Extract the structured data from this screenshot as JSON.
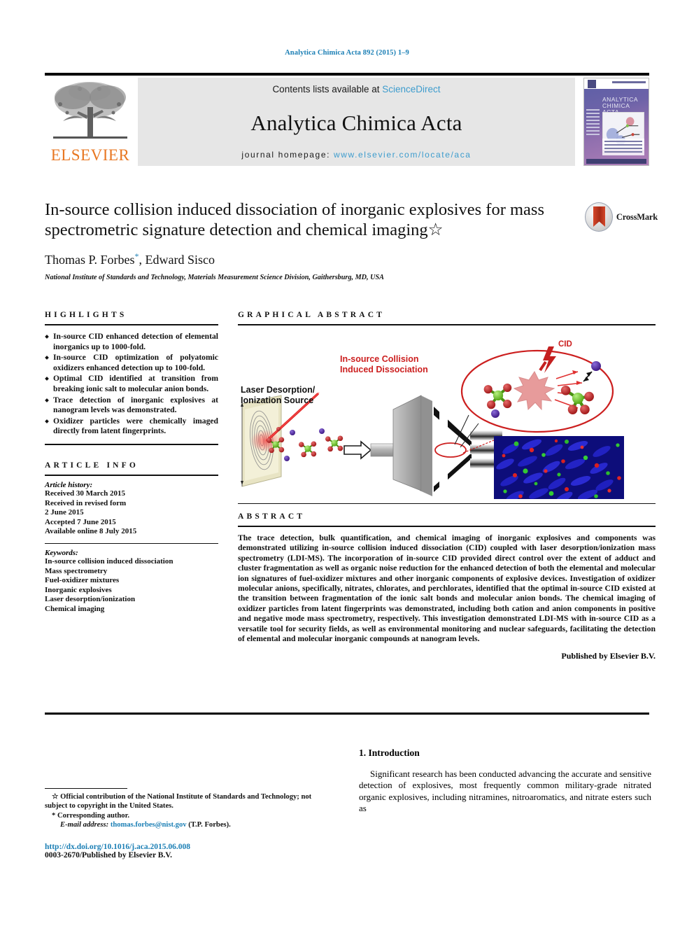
{
  "running_head": "Analytica Chimica Acta 892 (2015) 1–9",
  "masthead": {
    "publisher_name": "ELSEVIER",
    "publisher_logo": "elsevier-tree-logo",
    "contents_prefix": "Contents lists available at ",
    "contents_link": "ScienceDirect",
    "journal_title": "Analytica Chimica Acta",
    "homepage_prefix": "journal homepage: ",
    "homepage_url": "www.elsevier.com/locate/aca",
    "cover_journal_title": "ANALYTICA CHIMICA ACTA"
  },
  "article": {
    "title": "In-source collision induced dissociation of inorganic explosives for mass spectrometric signature detection and chemical imaging",
    "title_footnote_marker": "☆",
    "authors": "Thomas P. Forbes",
    "author_marker": "*",
    "authors_rest": ", Edward Sisco",
    "affiliation": "National Institute of Standards and Technology, Materials Measurement Science Division, Gaithersburg, MD, USA",
    "crossmark_label": "CrossMark"
  },
  "highlights": {
    "heading": "HIGHLIGHTS",
    "items": [
      "In-source CID enhanced detection of elemental inorganics up to 1000-fold.",
      "In-source CID optimization of polyatomic oxidizers enhanced detection up to 100-fold.",
      "Optimal CID identified at transition from breaking ionic salt to molecular anion bonds.",
      "Trace detection of inorganic explosives at nanogram levels was demonstrated.",
      "Oxidizer particles were chemically imaged directly from latent fingerprints."
    ]
  },
  "article_info": {
    "heading": "ARTICLE INFO",
    "history_label": "Article history:",
    "history": [
      "Received 30 March 2015",
      "Received in revised form",
      "2 June 2015",
      "Accepted 7 June 2015",
      "Available online 8 July 2015"
    ],
    "keywords_label": "Keywords:",
    "keywords": [
      "In-source collision induced dissociation",
      "Mass spectrometry",
      "Fuel-oxidizer mixtures",
      "Inorganic explosives",
      "Laser desorption/ionization",
      "Chemical imaging"
    ]
  },
  "graphical_abstract": {
    "heading": "GRAPHICAL ABSTRACT",
    "label_source": "Laser Desorption/\nIonization Source",
    "label_source_line1": "Laser Desorption/",
    "label_source_line2": "Ionization Source",
    "label_cid_line1": "In-source Collision",
    "label_cid_line2": "Induced Dissociation",
    "label_cid_arrow": "CID",
    "colors": {
      "red": "#cc1f1f",
      "dark_red": "#b31616",
      "oxygen": "#b01b1b",
      "central_atom": "#6fd01e",
      "cation": "#4b1f9e",
      "laser": "#e02020",
      "burst": "#e8a0a0",
      "image_blue": "#1b1bb4",
      "image_green": "#1fa81f",
      "image_red": "#d62020"
    }
  },
  "abstract": {
    "heading": "ABSTRACT",
    "body": "The trace detection, bulk quantification, and chemical imaging of inorganic explosives and components was demonstrated utilizing in-source collision induced dissociation (CID) coupled with laser desorption/ionization mass spectrometry (LDI-MS). The incorporation of in-source CID provided direct control over the extent of adduct and cluster fragmentation as well as organic noise reduction for the enhanced detection of both the elemental and molecular ion signatures of fuel-oxidizer mixtures and other inorganic components of explosive devices. Investigation of oxidizer molecular anions, specifically, nitrates, chlorates, and perchlorates, identified that the optimal in-source CID existed at the transition between fragmentation of the ionic salt bonds and molecular anion bonds. The chemical imaging of oxidizer particles from latent fingerprints was demonstrated, including both cation and anion components in positive and negative mode mass spectrometry, respectively. This investigation demonstrated LDI-MS with in-source CID as a versatile tool for security fields, as well as environmental monitoring and nuclear safeguards, facilitating the detection of elemental and molecular inorganic compounds at nanogram levels.",
    "published_by": "Published by Elsevier B.V."
  },
  "introduction": {
    "heading": "1. Introduction",
    "paragraph": "Significant research has been conducted advancing the accurate and sensitive detection of explosives, most frequently common military-grade nitrated organic explosives, including nitramines, nitroaromatics, and nitrate esters such as"
  },
  "footnotes": {
    "star_marker": "☆",
    "star_text": "Official contribution of the National Institute of Standards and Technology; not subject to copyright in the United States.",
    "corresponding_marker": "*",
    "corresponding_text": "Corresponding author.",
    "email_label": "E-mail address:",
    "email": "thomas.forbes@nist.gov",
    "email_suffix": "(T.P. Forbes).",
    "doi": "http://dx.doi.org/10.1016/j.aca.2015.06.008",
    "issn": "0003-2670/Published by Elsevier B.V."
  }
}
